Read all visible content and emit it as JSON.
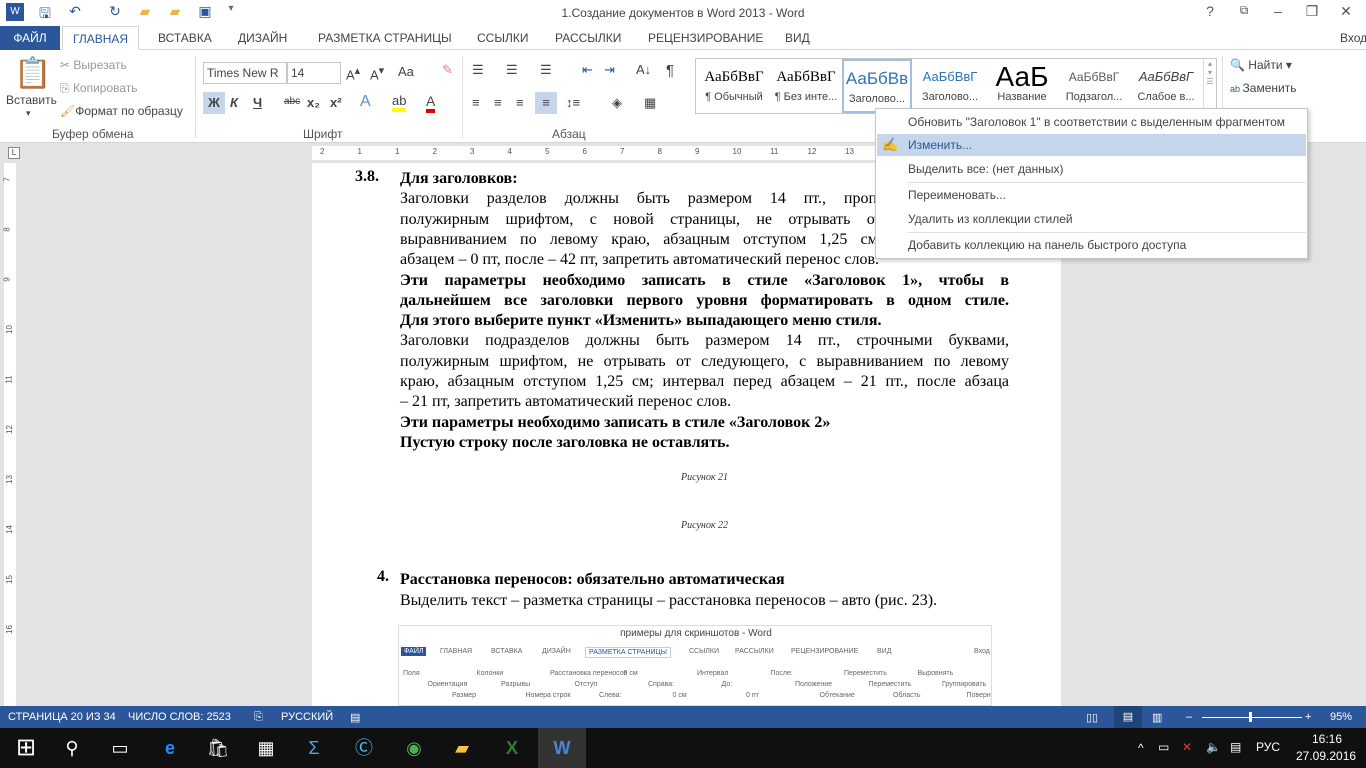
{
  "window": {
    "title": "1.Создание документов в Word 2013 - Word",
    "help": "?",
    "ribbon_display": "⧉",
    "minimize": "–",
    "restore": "❐",
    "close": "✕",
    "signin": "Вход"
  },
  "quick_access": {
    "app_icon": "word-icon",
    "save": "save-icon",
    "undo": "undo-icon",
    "redo": "redo-icon",
    "open": "folder-icon",
    "new_folder": "folder-icon",
    "customize": "customize-icon"
  },
  "tabs": [
    {
      "label": "ФАЙЛ"
    },
    {
      "label": "ГЛАВНАЯ",
      "active": true
    },
    {
      "label": "ВСТАВКА"
    },
    {
      "label": "ДИЗАЙН"
    },
    {
      "label": "РАЗМЕТКА СТРАНИЦЫ"
    },
    {
      "label": "ССЫЛКИ"
    },
    {
      "label": "РАССЫЛКИ"
    },
    {
      "label": "РЕЦЕНЗИРОВАНИЕ"
    },
    {
      "label": "ВИД"
    }
  ],
  "clipboard": {
    "paste": "Вставить",
    "cut": "Вырезать",
    "copy": "Копировать",
    "format_painter": "Формат по образцу",
    "label": "Буфер обмена"
  },
  "font": {
    "name": "Times New R",
    "size": "14",
    "label": "Шрифт",
    "case": "Aa",
    "bold": "Ж",
    "italic": "К",
    "underline": "Ч",
    "strike": "abc",
    "sub": "x₂",
    "sup": "x²"
  },
  "paragraph": {
    "label": "Абзац",
    "pilcrow": "¶"
  },
  "styles": {
    "items": [
      {
        "preview": "АаБбВвГ",
        "name": "¶ Обычный"
      },
      {
        "preview": "АаБбВвГ",
        "name": "¶ Без инте..."
      },
      {
        "preview": "АаБбВв",
        "name": "Заголово...",
        "current": true
      },
      {
        "preview": "АаБбВвГ",
        "name": "Заголово..."
      },
      {
        "preview": "АаБ",
        "name": "Название"
      },
      {
        "preview": "АаБбВвГ",
        "name": "Подзагол..."
      },
      {
        "preview": "АаБбВвГ",
        "name": "Слабое в..."
      }
    ]
  },
  "editing": {
    "find": "Найти",
    "replace": "Заменить"
  },
  "context_menu": {
    "items": [
      {
        "label": "Обновить \"Заголовок 1\" в соответствии с выделенным фрагментом"
      },
      {
        "label": "Изменить...",
        "highlighted": true
      },
      {
        "label": "Выделить все: (нет данных)"
      },
      {
        "label": "Переименовать..."
      },
      {
        "label": "Удалить из коллекции стилей"
      },
      {
        "label": "Добавить коллекцию на панель быстрого доступа"
      }
    ]
  },
  "ruler": {
    "marks": [
      "2",
      "1",
      "1",
      "2",
      "3",
      "4",
      "5",
      "6",
      "7",
      "8",
      "9",
      "10",
      "11",
      "12",
      "13",
      "14",
      "15",
      "16",
      "17"
    ]
  },
  "vruler": {
    "marks": [
      "7",
      "8",
      "9",
      "10",
      "11",
      "12",
      "13",
      "14",
      "15",
      "16"
    ]
  },
  "document": {
    "section_num": "3.8.",
    "lines": [
      {
        "t": "Для заголовков:",
        "b": true,
        "j": false
      },
      {
        "t": "Заголовки разделов должны быть размером 14 пт., прописными буквами,",
        "b": false,
        "j": true
      },
      {
        "t": "полужирным шрифтом, с новой страницы, не отрывать от следующего, с",
        "b": false,
        "j": true
      },
      {
        "t": "выравниванием по левому краю, абзацным отступом 1,25 см; интервал перед",
        "b": false,
        "j": true
      },
      {
        "t": "абзацем – 0 пт, после – 42 пт, запретить автоматический перенос слов.",
        "b": false,
        "j": false
      },
      {
        "t": "Эти параметры необходимо записать в стиле «Заголовок 1», чтобы в",
        "b": true,
        "j": true
      },
      {
        "t": "дальнейшем все заголовки первого уровня форматировать в одном стиле.",
        "b": true,
        "j": true
      },
      {
        "t": "Для этого выберите пункт «Изменить» выпадающего меню стиля.",
        "b": true,
        "j": false
      },
      {
        "t": "Заголовки подразделов должны быть размером 14 пт., строчными буквами,",
        "b": false,
        "j": true
      },
      {
        "t": "полужирным шрифтом, не отрывать от следующего, с выравниванием по левому",
        "b": false,
        "j": true
      },
      {
        "t": "краю, абзацным отступом 1,25 см; интервал перед абзацем – 21 пт., после абзаца",
        "b": false,
        "j": true
      },
      {
        "t": "– 21 пт, запретить автоматический перенос слов.",
        "b": false,
        "j": false
      },
      {
        "t": "Эти параметры необходимо записать в стиле «Заголовок 2»",
        "b": true,
        "j": false
      },
      {
        "t": "Пустую строку после заголовка не оставлять.",
        "b": true,
        "j": false
      }
    ],
    "caption21": "Рисунок 21",
    "caption22": "Рисунок 22",
    "section4_num": "4.",
    "section4_title": "Расстановка переносов: обязательно автоматическая",
    "section4_text": "Выделить текст – разметка страницы – расстановка переносов – авто (рис. 23)."
  },
  "embedded_screenshot": {
    "title": "примеры для скриншотов - Word",
    "tabs": [
      "ФАЙЛ",
      "ГЛАВНАЯ",
      "ВСТАВКА",
      "ДИЗАЙН",
      "РАЗМЕТКА СТРАНИЦЫ",
      "ССЫЛКИ",
      "РАССЫЛКИ",
      "РЕЦЕНЗИРОВАНИЕ",
      "ВИД"
    ],
    "signin": "Вход",
    "buttons": [
      "Поля",
      "Ориентация",
      "Размер",
      "Колонки",
      "Разрывы",
      "Номера строк",
      "Расстановка переносов",
      "Отступ",
      "Слева:",
      "0 см",
      "Справа:",
      "0 см",
      "Интервал",
      "До:",
      "0 пт",
      "После:",
      "Положение",
      "Обтекание",
      "Переместить",
      "Переместить",
      "Область",
      "Выровнять",
      "Группировать",
      "Повернуть"
    ]
  },
  "status": {
    "page": "СТРАНИЦА 20 ИЗ 34",
    "words": "ЧИСЛО СЛОВ: 2523",
    "language": "РУССКИЙ",
    "zoom": "95%",
    "zoom_percent": 95
  },
  "taskbar": {
    "time": "16:16",
    "date": "27.09.2016",
    "lang": "РУС"
  },
  "colors": {
    "accent": "#2b579a",
    "highlight": "#c5d5ea",
    "taskbar": "#101010"
  }
}
